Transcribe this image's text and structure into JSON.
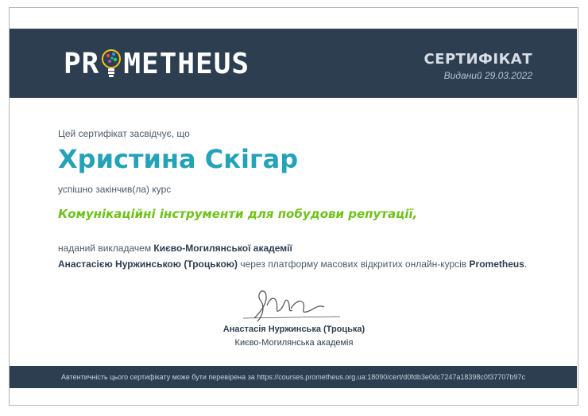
{
  "header": {
    "logo_left": "PR",
    "logo_right": "METHEUS",
    "certificate_title": "СЕРТИФІКАТ",
    "issued_date": "Виданий 29.03.2022"
  },
  "body": {
    "intro": "Цей сертифікат засвідчує, що",
    "student_name": "Христина Скігар",
    "completed": "успішно закінчив(ла) курс",
    "course_title": "Комунікаційні інструменти для побудови репутації,",
    "taught_prefix": "наданий викладачем ",
    "institution": "Києво-Могилянської академії",
    "instructor": "Анастасією Нуржинською (Троцькою)",
    "platform_text": " через платформу масових відкритих онлайн-курсів ",
    "platform_name": "Prometheus",
    "period": "."
  },
  "signature": {
    "name": "Анастасія Нуржинська (Троцька)",
    "organization": "Києво-Могилянська академія"
  },
  "footer": {
    "verification_text": "Автентичність цього сертифікату може бути перевірена за https://courses.prometheus.org.ua:18090/cert/d0fdb3e0dc7247a18398c0f37707b97c"
  },
  "colors": {
    "header_bg": "#2d3e50",
    "name_color": "#23a2b8",
    "course_color": "#6fc21a"
  }
}
